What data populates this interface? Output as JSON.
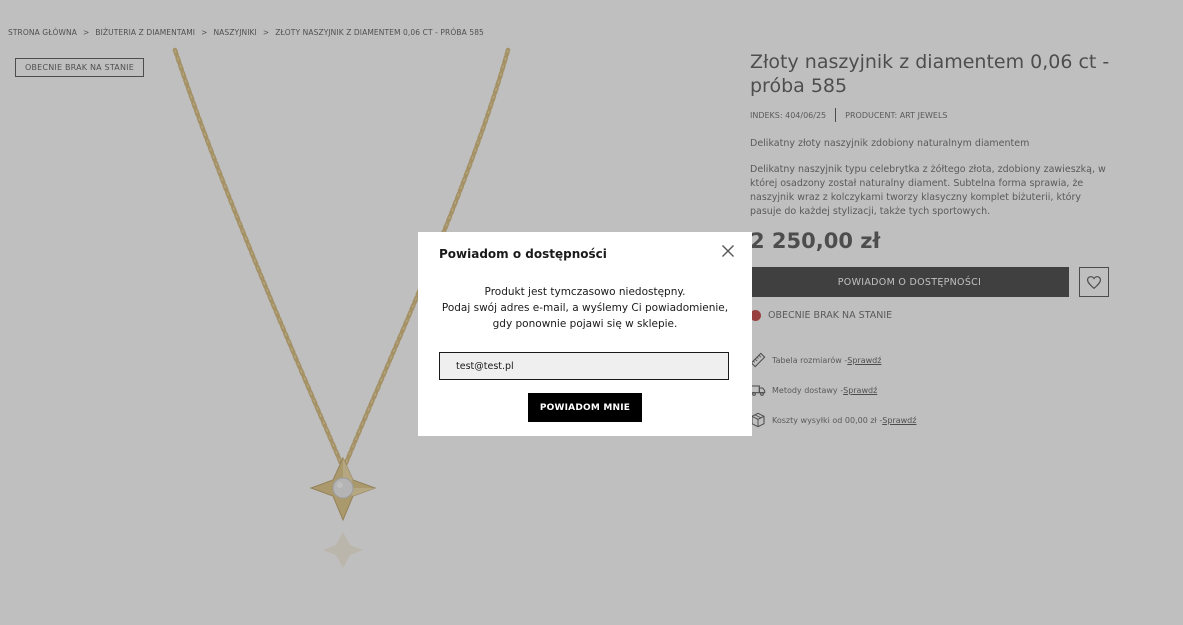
{
  "breadcrumb": {
    "items": [
      "STRONA GŁÓWNA",
      "BIŻUTERIA Z DIAMENTAMI",
      "NASZYJNIKI"
    ],
    "current": "ZŁOTY NASZYJNIK Z DIAMENTEM 0,06 CT - PRÓBA 585",
    "separator": ">"
  },
  "gallery": {
    "badge": "OBECNIE BRAK NA STANIE"
  },
  "product": {
    "title": "Złoty naszyjnik z diamentem 0,06 ct - próba 585",
    "index": "INDEKS: 404/06/25",
    "producer": "PRODUCENT: ART JEWELS",
    "short_description": "Delikatny złoty naszyjnik zdobiony naturalnym diamentem",
    "description": "Delikatny naszyjnik typu celebrytka z żółtego złota, zdobiony zawieszką, w której osadzony został naturalny diament. Subtelna forma sprawia, że naszyjnik wraz z kolczykami tworzy klasyczny komplet biżuterii, który pasuje do każdej stylizacji, także tych sportowych.",
    "price": "2 250,00 zł",
    "notify_button": "POWIADOM O DOSTĘPNOŚCI",
    "stock_status": "OBECNIE BRAK NA STANIE",
    "stock_color": "#b10000",
    "links": [
      {
        "label": "Tabela rozmiarów - ",
        "link": "Sprawdź",
        "icon": "ruler-icon"
      },
      {
        "label": "Metody dostawy - ",
        "link": "Sprawdź",
        "icon": "truck-icon"
      },
      {
        "label": "Koszty wysyłki od 00,00 zł - ",
        "link": "Sprawdź",
        "icon": "box-icon"
      }
    ]
  },
  "modal": {
    "title": "Powiadom o dostępności",
    "message_line1": "Produkt jest tymczasowo niedostępny.",
    "message_line2": "Podaj swój adres e-mail, a wyślemy Ci powiadomienie,",
    "message_line3": "gdy ponownie pojawi się w sklepie.",
    "email_value": "test@test.pl",
    "submit_label": "POWIADOM MNIE"
  }
}
